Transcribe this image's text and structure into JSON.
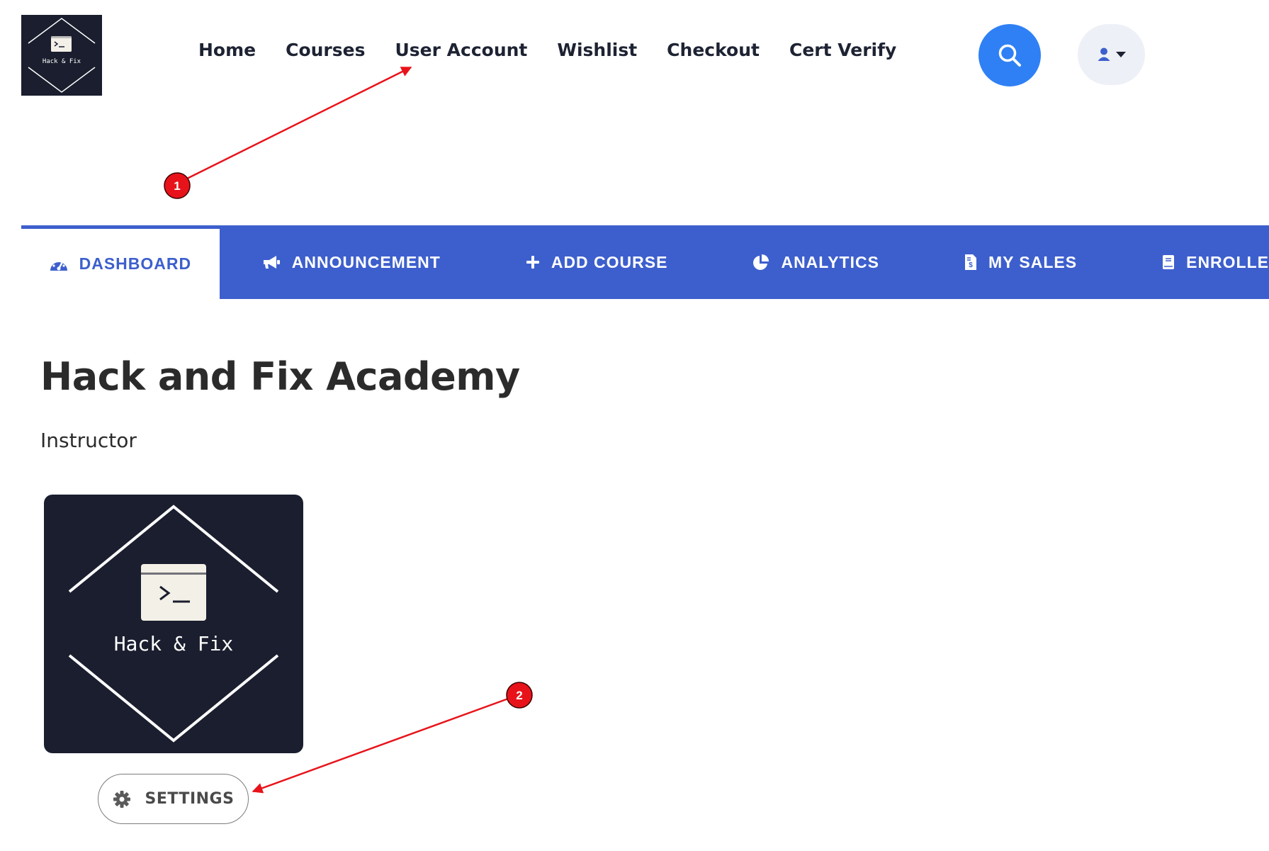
{
  "header": {
    "logo_text": "Hack & Fix",
    "nav": [
      "Home",
      "Courses",
      "User Account",
      "Wishlist",
      "Checkout",
      "Cert Verify"
    ],
    "search_icon": "search-icon",
    "user_icon": "user-icon"
  },
  "tabs": [
    {
      "label": "DASHBOARD",
      "icon": "gauge-icon",
      "active": true
    },
    {
      "label": "ANNOUNCEMENT",
      "icon": "megaphone-icon"
    },
    {
      "label": "ADD COURSE",
      "icon": "plus-icon"
    },
    {
      "label": "ANALYTICS",
      "icon": "pie-chart-icon"
    },
    {
      "label": "MY SALES",
      "icon": "invoice-icon"
    },
    {
      "label": "ENROLLE",
      "icon": "book-icon"
    }
  ],
  "profile": {
    "name": "Hack and Fix Academy",
    "role": "Instructor",
    "avatar_text": "Hack & Fix",
    "settings_label": "SETTINGS"
  },
  "annotations": [
    "1",
    "2"
  ],
  "colors": {
    "accent": "#3d5fcd",
    "search": "#2f80f5",
    "dark": "#1a1e2e",
    "arrow": "#e8131a"
  }
}
